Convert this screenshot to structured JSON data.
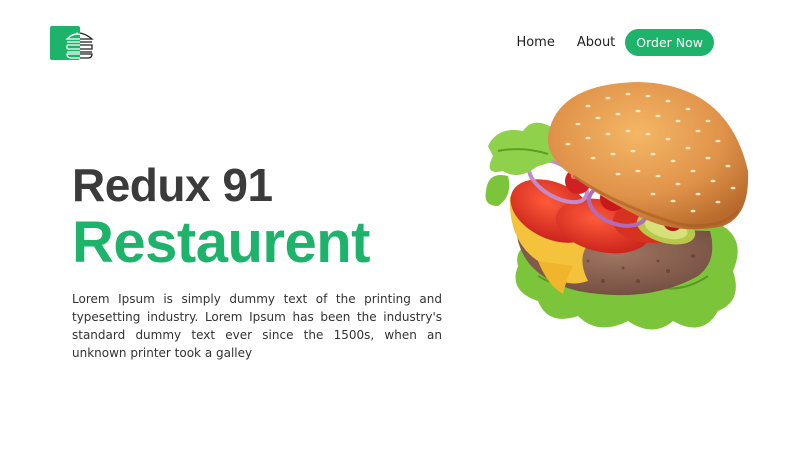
{
  "nav": {
    "home_label": "Home",
    "about_label": "About",
    "order_label": "Order Now"
  },
  "hero": {
    "title_line1": "Redux 91",
    "title_line2": "Restaurent",
    "description": "Lorem Ipsum is simply dummy text of the printing and typesetting industry. Lorem Ipsum has been the industry's standard dummy text ever since the 1500s, when an unknown printer took a galley"
  },
  "colors": {
    "accent": "#1db36b",
    "heading": "#3b3b3b",
    "text": "#333333",
    "background": "#ffffff"
  },
  "icons": {
    "logo": "burger-logo-icon",
    "hero_image": "burger-image"
  }
}
